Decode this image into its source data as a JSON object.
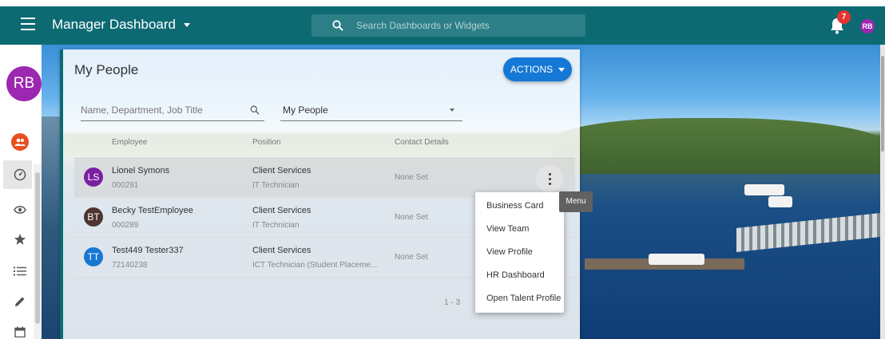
{
  "topbar": {
    "title": "Manager Dashboard",
    "search_placeholder": "Search Dashboards or Widgets",
    "notification_count": "7",
    "user_initials": "RB",
    "color": "#0d6a72"
  },
  "sidebar": {
    "user_initials": "RB",
    "icons": [
      "people-icon",
      "dashboard-gauge-icon",
      "eye-icon",
      "star-icon",
      "list-icon",
      "pencil-icon",
      "calendar-icon"
    ]
  },
  "card": {
    "title": "My People",
    "actions_label": "ACTIONS",
    "filter_placeholder": "Name, Department, Job Title",
    "select_value": "My People",
    "columns": [
      "Employee",
      "Position",
      "Contact Details"
    ],
    "rows": [
      {
        "initials": "LS",
        "name": "Lionel Symons",
        "id": "000291",
        "department": "Client Services",
        "job": "IT Technician",
        "contact": "None Set",
        "avatar_color": "#7b1fa2"
      },
      {
        "initials": "BT",
        "name": "Becky TestEmployee",
        "id": "000289",
        "department": "Client Services",
        "job": "IT Technician",
        "contact": "None Set",
        "avatar_color": "#4e342e"
      },
      {
        "initials": "TT",
        "name": "Test449 Tester337",
        "id": "72140238",
        "department": "Client Services",
        "job": "ICT Technician (Student Placeme...",
        "contact": "None Set",
        "avatar_color": "#1976d2"
      }
    ],
    "paging": "1 - 3"
  },
  "menu": {
    "tooltip": "Menu",
    "items": [
      "Business Card",
      "View Team",
      "View Profile",
      "HR Dashboard",
      "Open Talent Profile"
    ]
  },
  "colors": {
    "accent": "#1479d6",
    "badge": "#e8332f",
    "avatar_purple": "#9c27b0"
  }
}
